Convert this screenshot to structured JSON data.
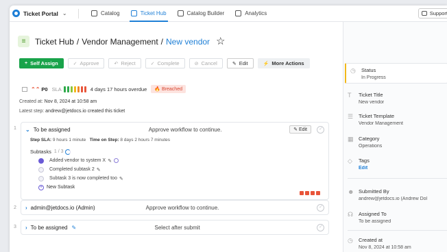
{
  "nav": {
    "brand": "Ticket Portal",
    "tabs": [
      {
        "label": "Catalog"
      },
      {
        "label": "Ticket Hub"
      },
      {
        "label": "Catalog Builder"
      },
      {
        "label": "Analytics"
      }
    ],
    "support": "Support"
  },
  "header": {
    "crumb1": "Ticket Hub",
    "crumb2": "Vendor Management",
    "crumb3": "New vendor",
    "sep": "/"
  },
  "toolbar": {
    "self_assign": "Self Assign",
    "approve": "Approve",
    "reject": "Reject",
    "complete": "Complete",
    "cancel": "Cancel",
    "edit": "Edit",
    "more": "More Actions"
  },
  "indicators": {
    "priority": "P0",
    "sla": "SLA",
    "sla_colors": [
      "#2eaa4a",
      "#2eaa4a",
      "#8cc43a",
      "#f2b81a",
      "#f0882a",
      "#e8553a",
      "#e8553a"
    ],
    "overdue": "4 days 17 hours overdue",
    "breached": "Breached"
  },
  "meta": {
    "created_label": "Created at:",
    "created_value": "Nov 8, 2024 at 10:58 am",
    "latest_label": "Latest step:",
    "latest_value": "andrew@jetdocs.io created this ticket"
  },
  "steps": [
    {
      "num": "1",
      "title": "To be assigned",
      "desc": "Approve workflow to continue.",
      "edit": "Edit",
      "sla_label": "Step SLA:",
      "sla_value": "9 hours 1 minute",
      "time_label": "Time on Step:",
      "time_value": "8 days 2 hours 7 minutes",
      "subtasks_label": "Subtasks",
      "subtasks_count": "1 / 3",
      "subtasks": [
        {
          "label": "Added vendor to system X"
        },
        {
          "label": "Completed subtask 2"
        },
        {
          "label": "Subtask 3 is now completed too"
        }
      ],
      "new_subtask": "New Subtask"
    },
    {
      "num": "2",
      "title": "admin@jetdocs.io (Admin)",
      "desc": "Approve workflow to continue."
    },
    {
      "num": "3",
      "title": "To be assigned",
      "desc": "Select after submit"
    }
  ],
  "panel": {
    "status_label": "Status",
    "status_value": "In Progress",
    "title_label": "Ticket Title",
    "title_value": "New vendor",
    "template_label": "Ticket Template",
    "template_value": "Vendor Management",
    "category_label": "Category",
    "category_value": "Operations",
    "tags_label": "Tags",
    "tags_value": "Edit",
    "submitted_label": "Submitted By",
    "submitted_value": "andrew@jetdocs.io (Andrew Dol",
    "assigned_label": "Assigned To",
    "assigned_value": "To be assigned",
    "created_label": "Created at",
    "created_value": "Nov 8, 2024 at 10:58 am"
  }
}
